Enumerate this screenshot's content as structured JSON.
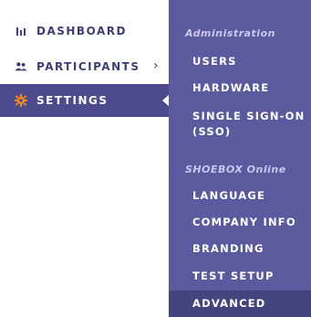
{
  "nav": {
    "items": [
      {
        "label": "DASHBOARD",
        "icon": "bar-chart-icon"
      },
      {
        "label": "PARTICIPANTS",
        "icon": "users-icon"
      },
      {
        "label": "SETTINGS",
        "icon": "gear-icon",
        "active": true
      }
    ]
  },
  "submenu": {
    "sections": [
      {
        "title": "Administration",
        "items": [
          "USERS",
          "HARDWARE",
          "SINGLE SIGN-ON (SSO)"
        ]
      },
      {
        "title": "SHOEBOX Online",
        "items": [
          "LANGUAGE",
          "COMPANY INFO",
          "BRANDING",
          "TEST SETUP",
          "ADVANCED"
        ]
      }
    ],
    "active_item": "ADVANCED"
  },
  "colors": {
    "nav_text": "#3c3f73",
    "settings_bg": "#4d4b8c",
    "panel_bg": "#5c5a9e",
    "active_bg": "#46447f",
    "gear_orange": "#f08a24"
  }
}
